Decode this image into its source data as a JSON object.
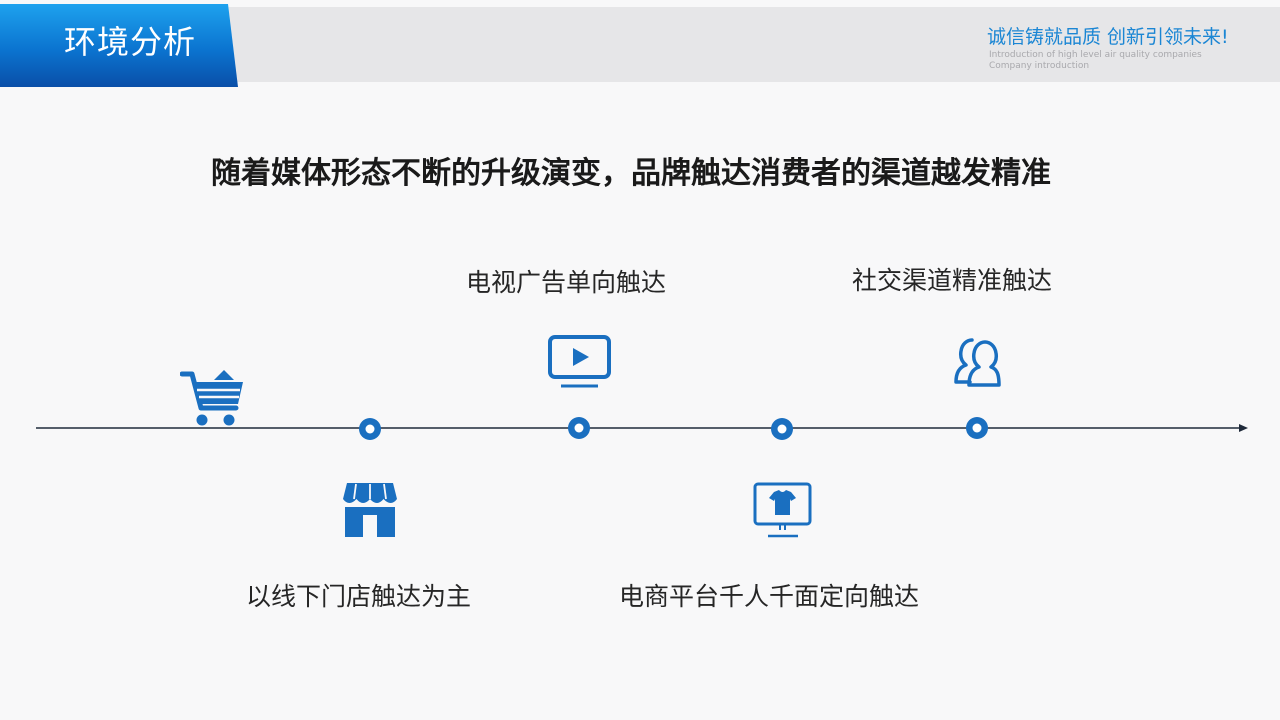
{
  "header": {
    "title": "环境分析",
    "slogan": "诚信铸就品质 创新引领未来!",
    "slogan_sub_1": "Introduction of high level air quality companies",
    "slogan_sub_2": "Company introduction"
  },
  "headline": "随着媒体形态不断的升级演变，品牌触达消费者的渠道越发精准",
  "timeline": {
    "stages": [
      {
        "label": "以线下门店触达为主",
        "icon": "store-icon"
      },
      {
        "label": "电视广告单向触达",
        "icon": "tv-play-icon"
      },
      {
        "label": "电商平台千人千面定向触达",
        "icon": "monitor-shirt-icon"
      },
      {
        "label": "社交渠道精准触达",
        "icon": "users-icon"
      }
    ],
    "start_icon": "shopping-cart-icon"
  },
  "colors": {
    "accent": "#1a6fc0",
    "tab_gradient_top": "#1ea2ee",
    "tab_gradient_bottom": "#0a4fa8",
    "header_bg": "#e6e6e8",
    "axis": "#1f2a3a"
  }
}
